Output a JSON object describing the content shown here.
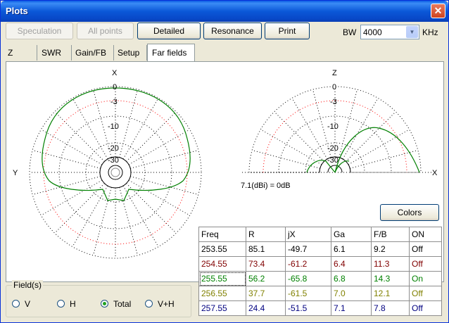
{
  "window": {
    "title": "Plots",
    "close_glyph": "✕"
  },
  "toolbar": {
    "speculation": "Speculation",
    "all_points": "All points",
    "detailed": "Detailed",
    "resonance": "Resonance",
    "print": "Print",
    "bw_label": "BW",
    "bw_value": "4000",
    "bw_unit": "KHz"
  },
  "tabs": [
    "Z",
    "SWR",
    "Gain/FB",
    "Setup",
    "Far fields"
  ],
  "plot": {
    "left_axis_top": "X",
    "left_axis_left": "Y",
    "right_axis_top": "Z",
    "right_axis_right": "X",
    "ring_labels": [
      "0",
      "-3",
      "-10",
      "-20",
      "-30"
    ],
    "ref_text": "7.1(dBi) = 0dB",
    "grid_color": "#000000",
    "ref_circle_color": "#ff0000",
    "pattern_color": "#008000"
  },
  "colors_button": "Colors",
  "field_group": {
    "legend": "Field(s)",
    "options": [
      "V",
      "H",
      "Total",
      "V+H"
    ],
    "selected": "Total"
  },
  "table": {
    "headers": [
      "Freq",
      "R",
      "jX",
      "Ga",
      "F/B",
      "ON"
    ],
    "rows": [
      {
        "cells": [
          "253.55",
          "85.1",
          "-49.7",
          "6.1",
          "9.2",
          "Off"
        ],
        "color": "#000000"
      },
      {
        "cells": [
          "254.55",
          "73.4",
          "-61.2",
          "6.4",
          "11.3",
          "Off"
        ],
        "color": "#800000"
      },
      {
        "cells": [
          "255.55",
          "56.2",
          "-65.8",
          "6.8",
          "14.3",
          "On"
        ],
        "color": "#008000"
      },
      {
        "cells": [
          "256.55",
          "37.7",
          "-61.5",
          "7.0",
          "12.1",
          "Off"
        ],
        "color": "#808000"
      },
      {
        "cells": [
          "257.55",
          "24.4",
          "-51.5",
          "7.1",
          "7.8",
          "Off"
        ],
        "color": "#000080"
      }
    ]
  }
}
